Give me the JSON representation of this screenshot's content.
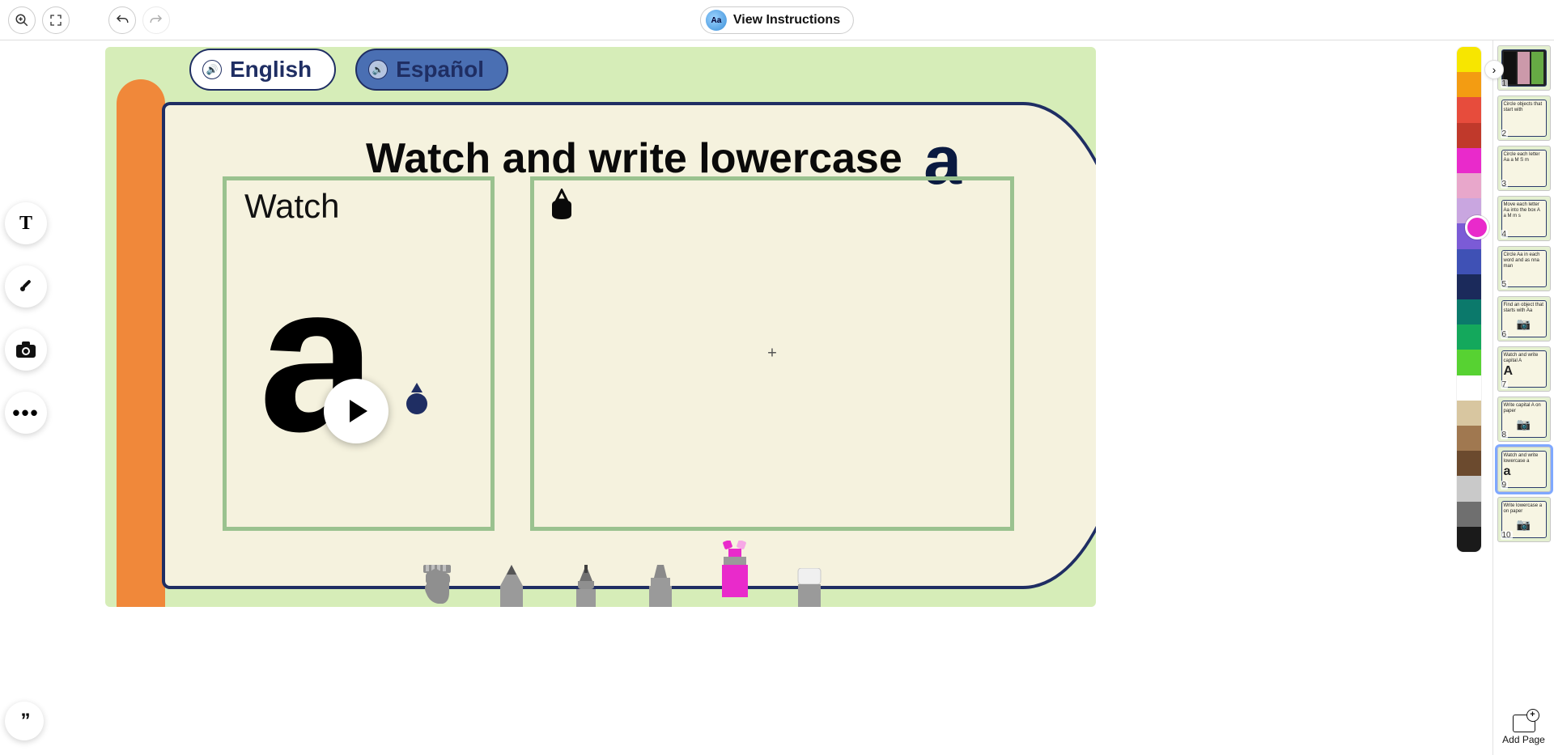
{
  "toolbar": {
    "view_instructions": "View Instructions",
    "avatar_label": "Aa"
  },
  "slide": {
    "lang_english": "English",
    "lang_spanish": "Español",
    "headline_prefix": "Watch and write lowercase",
    "headline_letter": "a",
    "watch_label": "Watch",
    "cross_mark": "+"
  },
  "colors": {
    "strip": [
      "#f7e600",
      "#f39c12",
      "#e74c3c",
      "#c0392b",
      "#e92acb",
      "#e8a7cb",
      "#c9a6e0",
      "#7b5bd6",
      "#3f51b5",
      "#1b2a5b",
      "#0b796b",
      "#14a85c",
      "#57d232",
      "#ffffff",
      "#d8c6a0",
      "#a07850",
      "#6b4a2e",
      "#c9c9c9",
      "#6f6f6f",
      "#1a1a1a"
    ],
    "current": "#e92acb"
  },
  "thumbnails": [
    {
      "num": "1",
      "title": ""
    },
    {
      "num": "2",
      "title": "Circle objects that start with"
    },
    {
      "num": "3",
      "title": "Circle each letter Aa  a  M  S  m"
    },
    {
      "num": "4",
      "title": "Move each letter Aa into the box  A a M m s"
    },
    {
      "num": "5",
      "title": "Circle Aa in each word   and   as   nna   man"
    },
    {
      "num": "6",
      "title": "Find an object that starts with Aa"
    },
    {
      "num": "7",
      "title": "Watch and write capital A"
    },
    {
      "num": "8",
      "title": "Write capital A on paper"
    },
    {
      "num": "9",
      "title": "Watch and write lowercase a"
    },
    {
      "num": "10",
      "title": "Write lowercase a on paper"
    }
  ],
  "add_page_label": "Add Page"
}
